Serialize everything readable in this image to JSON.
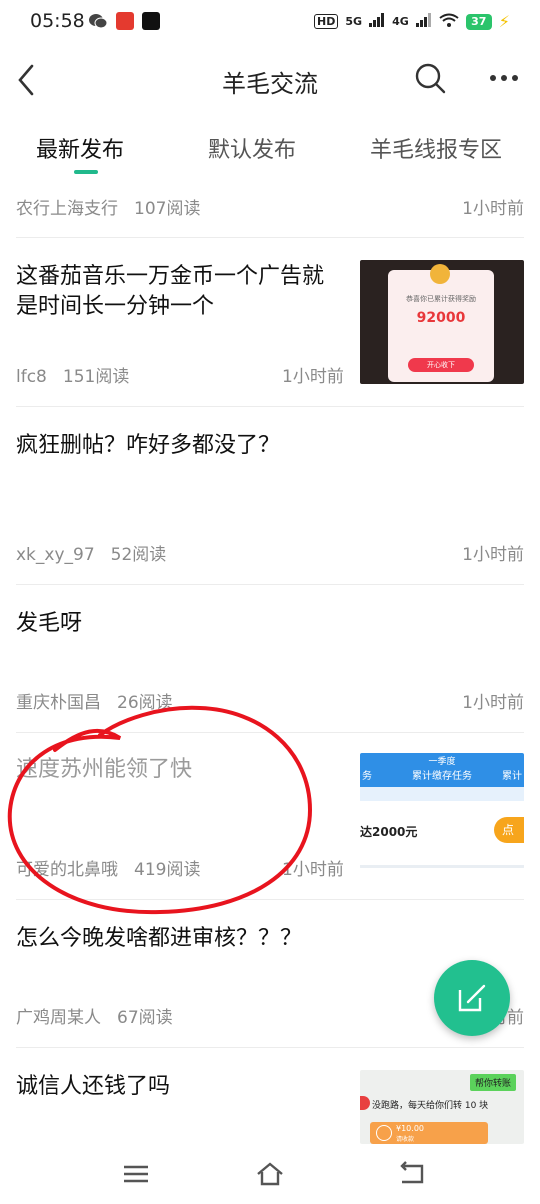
{
  "status": {
    "time": "05:58",
    "battery": "37",
    "net1": "5G",
    "net2": "4G",
    "hd": "HD"
  },
  "header": {
    "title": "羊毛交流"
  },
  "tabs": [
    {
      "label": "最新发布",
      "active": true
    },
    {
      "label": "默认发布",
      "active": false
    },
    {
      "label": "羊毛线报专区",
      "active": false
    }
  ],
  "posts": [
    {
      "title": "",
      "author": "农行上海支行",
      "reads": "107阅读",
      "time": "1小时前"
    },
    {
      "title": "这番茄音乐一万金币一个广告就是时间长一分钟一个",
      "author": "lfc8",
      "reads": "151阅读",
      "time": "1小时前",
      "thumb": {
        "amount": "92000",
        "caption": "恭喜你已累计获得奖励",
        "button": "开心收下"
      }
    },
    {
      "title": "疯狂删帖？咋好多都没了？",
      "author": "xk_xy_97",
      "reads": "52阅读",
      "time": "1小时前"
    },
    {
      "title": "发毛呀",
      "author": "重庆朴国昌",
      "reads": "26阅读",
      "time": "1小时前"
    },
    {
      "title": "速度苏州能领了快",
      "author": "可爱的北鼻哦",
      "reads": "419阅读",
      "time": "1小时前",
      "thumb": {
        "top": "一季度",
        "sub": "累计缴存任务",
        "left": "务",
        "right": "累计",
        "amount": "达2000元",
        "btn": "点"
      }
    },
    {
      "title": "怎么今晚发啥都进审核？？？",
      "author": "广鸡周某人",
      "reads": "67阅读",
      "time": "1小时前"
    },
    {
      "title": "诚信人还钱了吗",
      "thumb": {
        "tag": "帮你转账",
        "line": "没跑路，每天给你们转 10 块",
        "amt": "¥10.00",
        "note": "请收款"
      }
    }
  ],
  "colors": {
    "accent": "#21b98c",
    "fab": "#22c08f",
    "annotation": "#e8141e"
  }
}
